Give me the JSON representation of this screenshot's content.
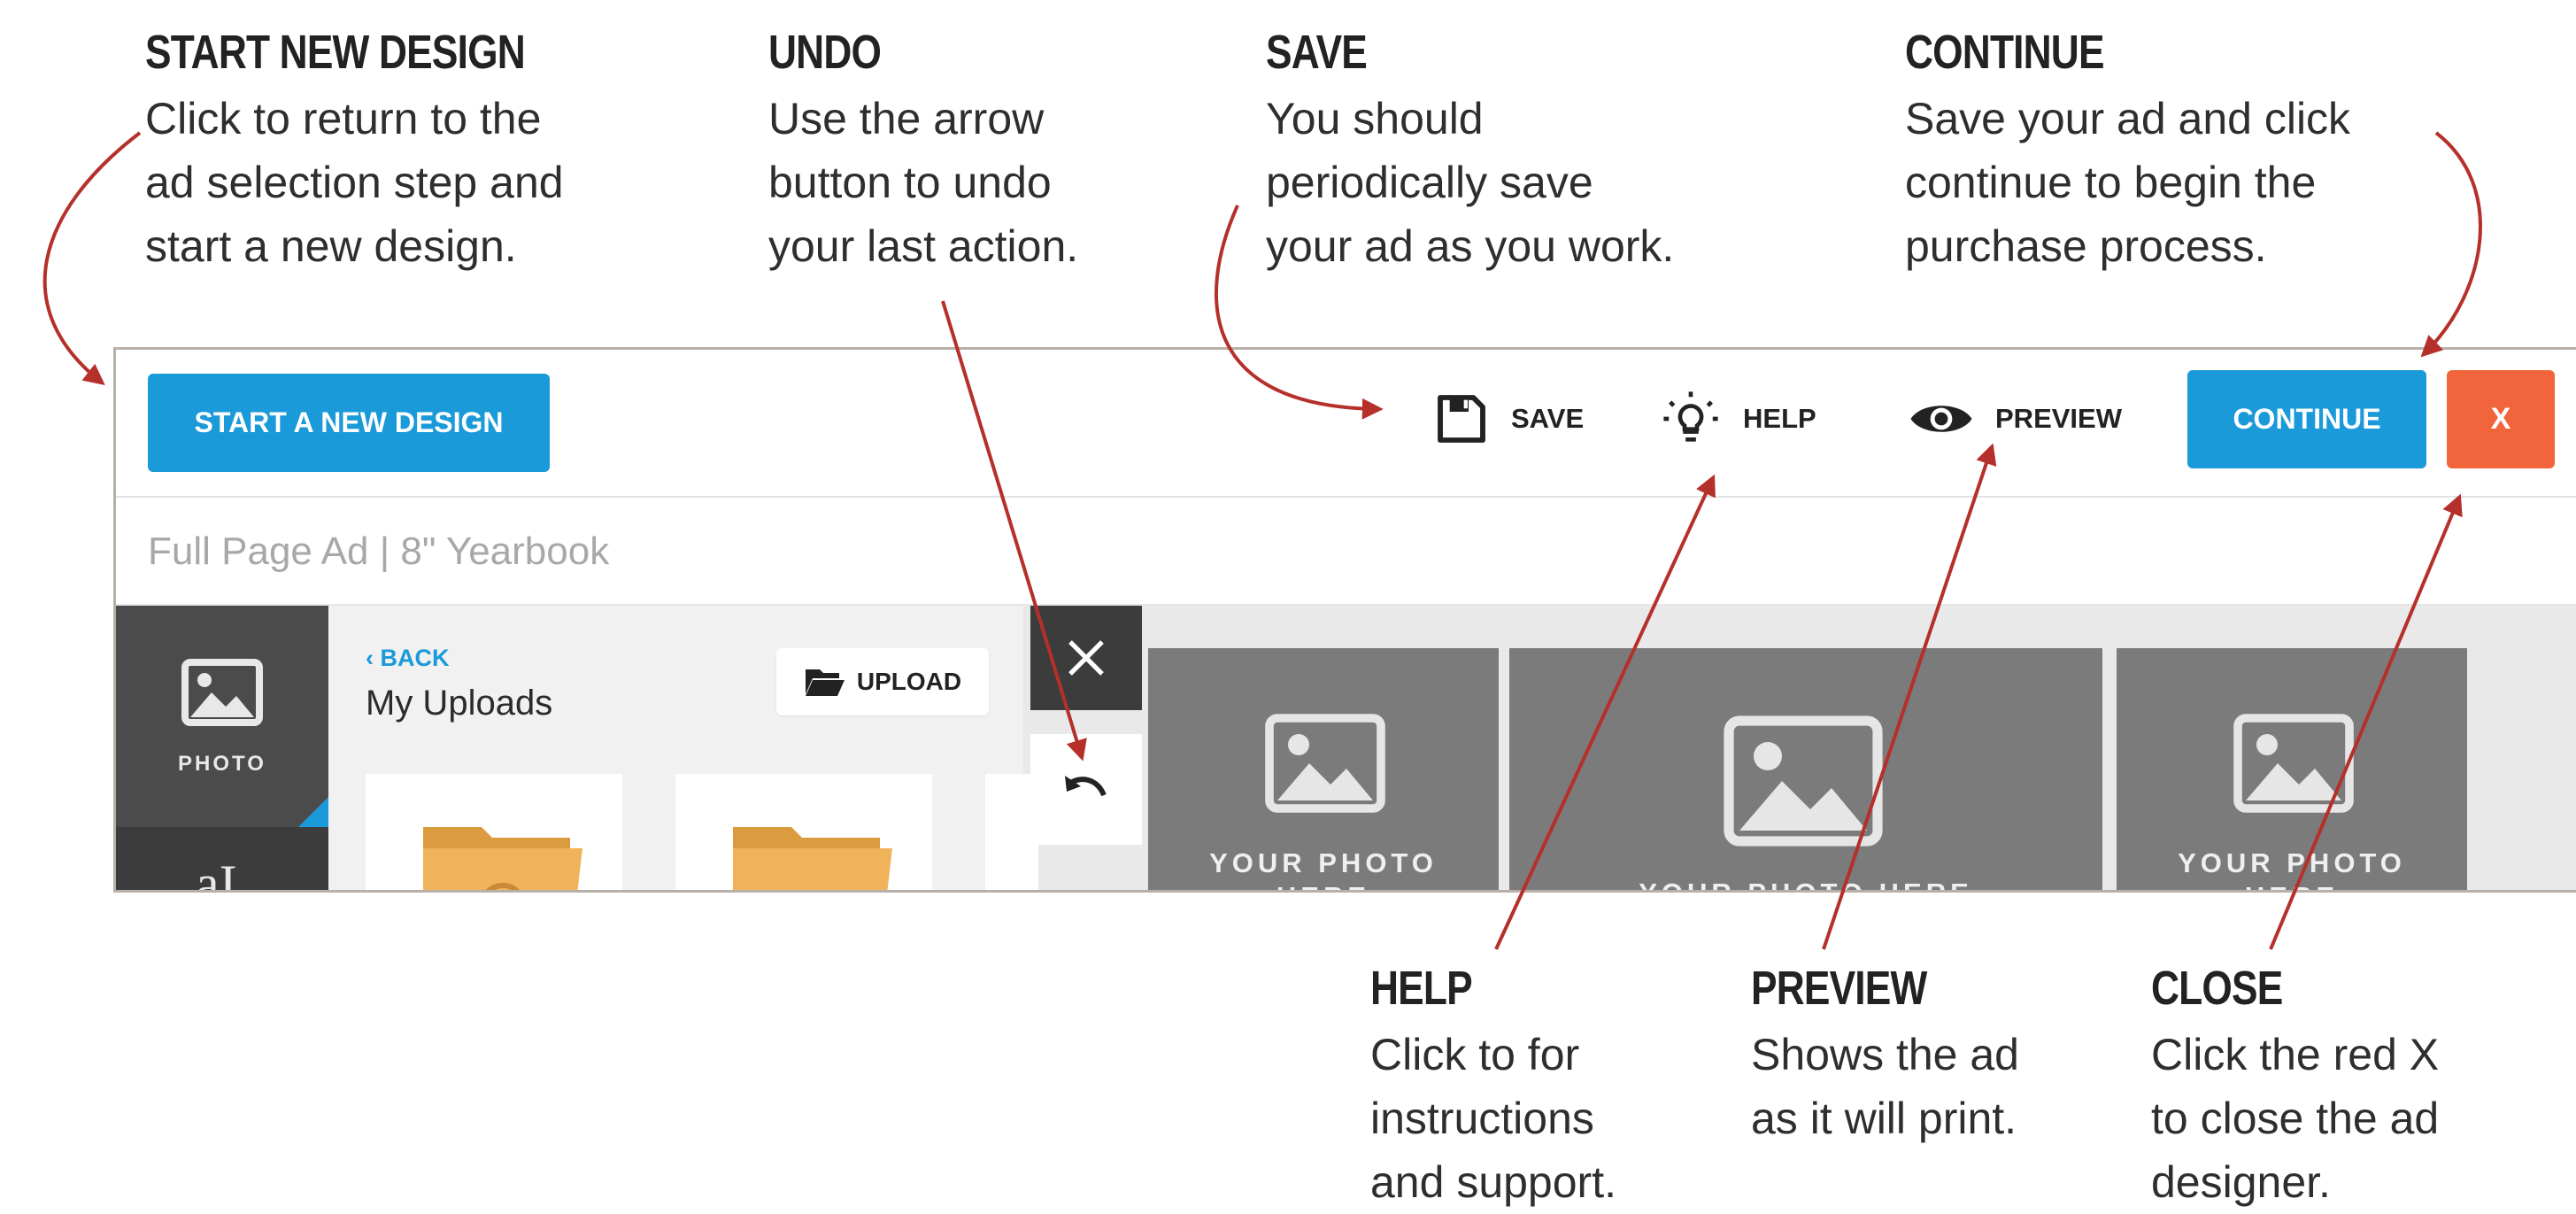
{
  "annotations": {
    "start_new_design": {
      "title": "START NEW DESIGN",
      "lines": [
        "Click to return to the",
        "ad selection step and",
        "start a new design."
      ]
    },
    "undo": {
      "title": "UNDO",
      "lines": [
        "Use the arrow",
        "button to undo",
        "your last action."
      ]
    },
    "save": {
      "title": "SAVE",
      "lines": [
        "You should",
        "periodically save",
        "your ad as you work."
      ]
    },
    "continue": {
      "title": "CONTINUE",
      "lines": [
        "Save your ad and click",
        "continue to begin the",
        "purchase process."
      ]
    },
    "help": {
      "title": "HELP",
      "lines": [
        "Click to for",
        "instructions",
        "and support."
      ]
    },
    "preview": {
      "title": "PREVIEW",
      "lines": [
        "Shows the ad",
        "as it will print."
      ]
    },
    "close": {
      "title": "CLOSE",
      "lines": [
        "Click the red X",
        "to close the ad",
        "designer."
      ]
    }
  },
  "toolbar": {
    "start_label": "START A NEW DESIGN",
    "save_label": "SAVE",
    "help_label": "HELP",
    "preview_label": "PREVIEW",
    "continue_label": "CONTINUE",
    "close_label": "X"
  },
  "document_label": "Full Page Ad | 8\" Yearbook",
  "left_rail": {
    "photo_label": "PHOTO"
  },
  "uploads_panel": {
    "back_label": "BACK",
    "title": "My Uploads",
    "upload_label": "UPLOAD"
  },
  "photo_slots": [
    {
      "label_line1": "YOUR PHOTO",
      "label_line2": "HERE"
    },
    {
      "label_line1": "YOUR PHOTO HERE",
      "label_line2": ""
    },
    {
      "label_line1": "YOUR PHOTO",
      "label_line2": "HERE"
    }
  ],
  "colors": {
    "accent_blue": "#1a9ad9",
    "close_red": "#f2643c",
    "arrow_red": "#b5302a",
    "rail_dark": "#3c3c3c",
    "folder_orange": "#f0b35a"
  }
}
